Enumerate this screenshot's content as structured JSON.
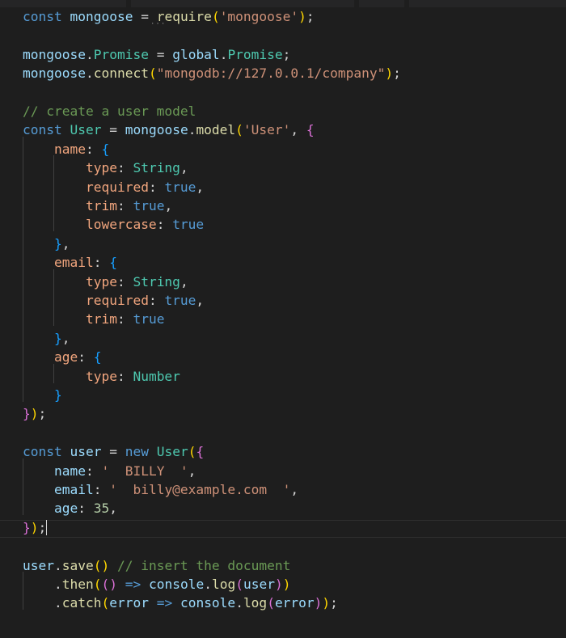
{
  "editor": {
    "lines": [
      [
        [
          "k",
          "const"
        ],
        [
          "p",
          " "
        ],
        [
          "v",
          "mongoose"
        ],
        [
          "p",
          " = "
        ],
        [
          "f",
          "require"
        ],
        [
          "b1",
          "("
        ],
        [
          "s",
          "'mongoose'"
        ],
        [
          "b1",
          ")"
        ],
        [
          "p",
          ";"
        ]
      ],
      [],
      [
        [
          "v",
          "mongoose"
        ],
        [
          "p",
          "."
        ],
        [
          "t",
          "Promise"
        ],
        [
          "p",
          " = "
        ],
        [
          "v",
          "global"
        ],
        [
          "p",
          "."
        ],
        [
          "t",
          "Promise"
        ],
        [
          "p",
          ";"
        ]
      ],
      [
        [
          "v",
          "mongoose"
        ],
        [
          "p",
          "."
        ],
        [
          "f",
          "connect"
        ],
        [
          "b1",
          "("
        ],
        [
          "s",
          "\"mongodb://127.0.0.1/company\""
        ],
        [
          "b1",
          ")"
        ],
        [
          "p",
          ";"
        ]
      ],
      [],
      [
        [
          "c",
          "// create a user model"
        ]
      ],
      [
        [
          "k",
          "const"
        ],
        [
          "p",
          " "
        ],
        [
          "t",
          "User"
        ],
        [
          "p",
          " = "
        ],
        [
          "v",
          "mongoose"
        ],
        [
          "p",
          "."
        ],
        [
          "f",
          "model"
        ],
        [
          "b1",
          "("
        ],
        [
          "s",
          "'User'"
        ],
        [
          "p",
          ", "
        ],
        [
          "b2",
          "{"
        ]
      ],
      [
        [
          "p",
          "    "
        ],
        [
          "pr",
          "name"
        ],
        [
          "p",
          ": "
        ],
        [
          "b3",
          "{"
        ]
      ],
      [
        [
          "p",
          "        "
        ],
        [
          "pr",
          "type"
        ],
        [
          "p",
          ": "
        ],
        [
          "t",
          "String"
        ],
        [
          "p",
          ","
        ]
      ],
      [
        [
          "p",
          "        "
        ],
        [
          "pr",
          "required"
        ],
        [
          "p",
          ": "
        ],
        [
          "k",
          "true"
        ],
        [
          "p",
          ","
        ]
      ],
      [
        [
          "p",
          "        "
        ],
        [
          "pr",
          "trim"
        ],
        [
          "p",
          ": "
        ],
        [
          "k",
          "true"
        ],
        [
          "p",
          ","
        ]
      ],
      [
        [
          "p",
          "        "
        ],
        [
          "pr",
          "lowercase"
        ],
        [
          "p",
          ": "
        ],
        [
          "k",
          "true"
        ]
      ],
      [
        [
          "p",
          "    "
        ],
        [
          "b3",
          "}"
        ],
        [
          "p",
          ","
        ]
      ],
      [
        [
          "p",
          "    "
        ],
        [
          "pr",
          "email"
        ],
        [
          "p",
          ": "
        ],
        [
          "b3",
          "{"
        ]
      ],
      [
        [
          "p",
          "        "
        ],
        [
          "pr",
          "type"
        ],
        [
          "p",
          ": "
        ],
        [
          "t",
          "String"
        ],
        [
          "p",
          ","
        ]
      ],
      [
        [
          "p",
          "        "
        ],
        [
          "pr",
          "required"
        ],
        [
          "p",
          ": "
        ],
        [
          "k",
          "true"
        ],
        [
          "p",
          ","
        ]
      ],
      [
        [
          "p",
          "        "
        ],
        [
          "pr",
          "trim"
        ],
        [
          "p",
          ": "
        ],
        [
          "k",
          "true"
        ]
      ],
      [
        [
          "p",
          "    "
        ],
        [
          "b3",
          "}"
        ],
        [
          "p",
          ","
        ]
      ],
      [
        [
          "p",
          "    "
        ],
        [
          "pr",
          "age"
        ],
        [
          "p",
          ": "
        ],
        [
          "b3",
          "{"
        ]
      ],
      [
        [
          "p",
          "        "
        ],
        [
          "pr",
          "type"
        ],
        [
          "p",
          ": "
        ],
        [
          "t",
          "Number"
        ]
      ],
      [
        [
          "p",
          "    "
        ],
        [
          "b3",
          "}"
        ]
      ],
      [
        [
          "b2",
          "}"
        ],
        [
          "b1",
          ")"
        ],
        [
          "p",
          ";"
        ]
      ],
      [],
      [
        [
          "k",
          "const"
        ],
        [
          "p",
          " "
        ],
        [
          "v",
          "user"
        ],
        [
          "p",
          " = "
        ],
        [
          "k",
          "new"
        ],
        [
          "p",
          " "
        ],
        [
          "t",
          "User"
        ],
        [
          "b1",
          "("
        ],
        [
          "b2",
          "{"
        ]
      ],
      [
        [
          "p",
          "    "
        ],
        [
          "v",
          "name"
        ],
        [
          "p",
          ": "
        ],
        [
          "s",
          "'  BILLY  '"
        ],
        [
          "p",
          ","
        ]
      ],
      [
        [
          "p",
          "    "
        ],
        [
          "v",
          "email"
        ],
        [
          "p",
          ": "
        ],
        [
          "s",
          "'  billy@example.com  '"
        ],
        [
          "p",
          ","
        ]
      ],
      [
        [
          "p",
          "    "
        ],
        [
          "v",
          "age"
        ],
        [
          "p",
          ": "
        ],
        [
          "n",
          "35"
        ],
        [
          "p",
          ","
        ]
      ],
      [
        [
          "b2",
          "}"
        ],
        [
          "b1",
          ")"
        ],
        [
          "p",
          ";"
        ]
      ],
      [],
      [
        [
          "v",
          "user"
        ],
        [
          "p",
          "."
        ],
        [
          "f",
          "save"
        ],
        [
          "b1",
          "()"
        ],
        [
          "p",
          " "
        ],
        [
          "c",
          "// insert the document"
        ]
      ],
      [
        [
          "p",
          "    ."
        ],
        [
          "f",
          "then"
        ],
        [
          "b1",
          "("
        ],
        [
          "b2",
          "()"
        ],
        [
          "p",
          " "
        ],
        [
          "k",
          "=>"
        ],
        [
          "p",
          " "
        ],
        [
          "v",
          "console"
        ],
        [
          "p",
          "."
        ],
        [
          "f",
          "log"
        ],
        [
          "b2",
          "("
        ],
        [
          "v",
          "user"
        ],
        [
          "b2",
          ")"
        ],
        [
          "b1",
          ")"
        ]
      ],
      [
        [
          "p",
          "    ."
        ],
        [
          "f",
          "catch"
        ],
        [
          "b1",
          "("
        ],
        [
          "v",
          "error"
        ],
        [
          "p",
          " "
        ],
        [
          "k",
          "=>"
        ],
        [
          "p",
          " "
        ],
        [
          "v",
          "console"
        ],
        [
          "p",
          "."
        ],
        [
          "f",
          "log"
        ],
        [
          "b2",
          "("
        ],
        [
          "v",
          "error"
        ],
        [
          "b2",
          ")"
        ],
        [
          "b1",
          ")"
        ],
        [
          "p",
          ";"
        ]
      ]
    ]
  }
}
